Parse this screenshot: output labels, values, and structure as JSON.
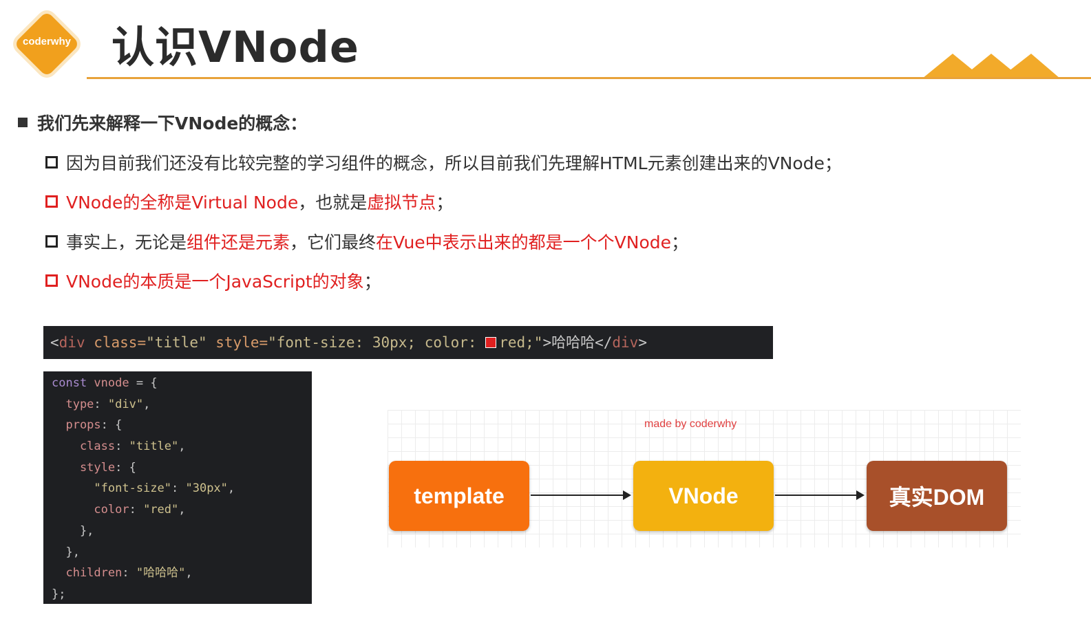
{
  "logo": {
    "text": "coderwhy",
    "color": "#f1a01d"
  },
  "title": "认识VNode",
  "main_bullet": "我们先来解释一下VNode的概念：",
  "bullets": [
    {
      "parts": [
        "因为目前我们还没有比较完整的学习组件的概念，所以目前我们先理解HTML元素创建出来的VNode；"
      ]
    },
    {
      "parts": [
        "VNode的全称是Virtual Node",
        "，也就是",
        "虚拟节点",
        "；"
      ]
    },
    {
      "parts": [
        "事实上，无论是",
        "组件还是元素",
        "，它们最终",
        "在Vue中表示出来的都是一个个VNode",
        "；"
      ]
    },
    {
      "parts": [
        "VNode的本质是一个JavaScript的对象",
        "；"
      ]
    }
  ],
  "html_code": {
    "t1": "<",
    "t2": "div",
    "t3": " class=",
    "t4": "\"title\"",
    "t5": " style=",
    "t6": "\"font-size: 30px; color: ",
    "t7": "red;\"",
    "t8": ">哈哈哈</",
    "t9": "div",
    "t10": ">"
  },
  "vnode_code": {
    "l1a": "const ",
    "l1b": "vnode",
    "l1c": " = {",
    "l2a": "  type",
    "l2b": ": ",
    "l2c": "\"div\"",
    "l2d": ",",
    "l3a": "  props",
    "l3b": ": {",
    "l4a": "    class",
    "l4b": ": ",
    "l4c": "\"title\"",
    "l4d": ",",
    "l5a": "    style",
    "l5b": ": {",
    "l6a": "      \"font-size\"",
    "l6b": ": ",
    "l6c": "\"30px\"",
    "l6d": ",",
    "l7a": "      color",
    "l7b": ": ",
    "l7c": "\"red\"",
    "l7d": ",",
    "l8": "    },",
    "l9": "  },",
    "l10a": "  children",
    "l10b": ": ",
    "l10c": "\"哈哈哈\"",
    "l10d": ",",
    "l11": "};"
  },
  "diagram": {
    "made_by": "made by coderwhy",
    "nodes": [
      {
        "label": "template",
        "color": "#f7700e"
      },
      {
        "label": "VNode",
        "color": "#f3b10f"
      },
      {
        "label": "真实DOM",
        "color": "#a8502a"
      }
    ]
  }
}
